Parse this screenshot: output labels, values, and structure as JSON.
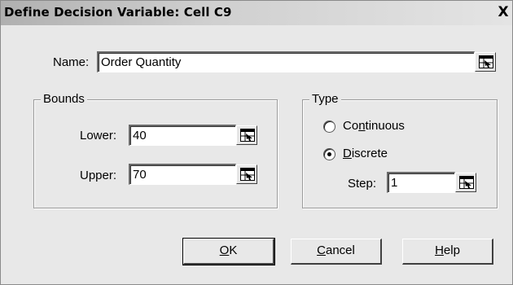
{
  "window": {
    "title": "Define Decision Variable: Cell C9",
    "close_symbol": "X"
  },
  "name": {
    "label": "Name:",
    "value": "Order Quantity"
  },
  "bounds": {
    "group_label": "Bounds",
    "lower_label": "Lower:",
    "lower_value": "40",
    "upper_label": "Upper:",
    "upper_value": "70"
  },
  "type": {
    "group_label": "Type",
    "options": [
      {
        "pre": "Co",
        "mnemonic": "n",
        "post": "tinuous",
        "selected": false
      },
      {
        "pre": "",
        "mnemonic": "D",
        "post": "iscrete",
        "selected": true
      }
    ],
    "step_label": "Step:",
    "step_value": "1"
  },
  "buttons": {
    "ok": {
      "mnemonic": "O",
      "rest": "K"
    },
    "cancel": {
      "mnemonic": "C",
      "rest": "ancel"
    },
    "help": {
      "mnemonic": "H",
      "rest": "elp"
    }
  },
  "icons": {
    "cell_reference": "cell-reference-icon"
  }
}
